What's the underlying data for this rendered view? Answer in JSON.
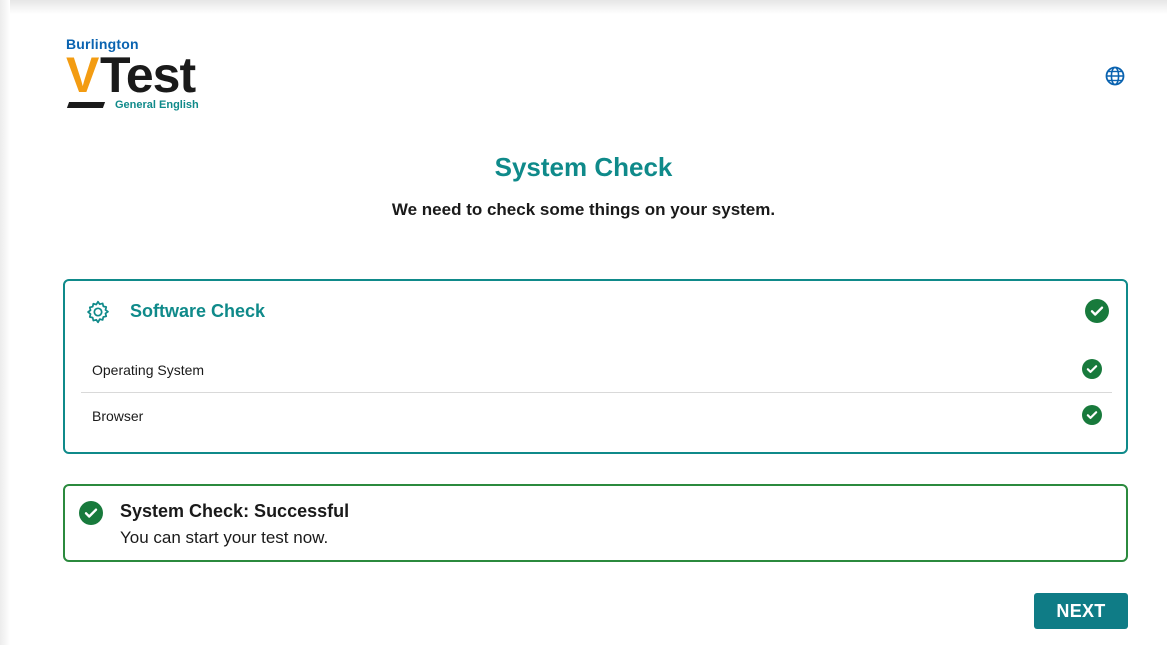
{
  "logo": {
    "brand": "Burlington",
    "v": "V",
    "test": "Test",
    "sub": "General English"
  },
  "header": {
    "language_icon": "globe-icon"
  },
  "page": {
    "title": "System Check",
    "subtitle": "We need to check some things on your system."
  },
  "software_check": {
    "icon": "gear-icon",
    "title": "Software Check",
    "status_icon": "check-circle-icon",
    "items": [
      {
        "label": "Operating System",
        "status_icon": "check-circle-icon"
      },
      {
        "label": "Browser",
        "status_icon": "check-circle-icon"
      }
    ]
  },
  "status": {
    "icon": "check-circle-icon",
    "title": "System Check: Successful",
    "message": "You can start your test now."
  },
  "actions": {
    "next_label": "NEXT"
  },
  "colors": {
    "teal": "#0f8a8a",
    "button": "#0f7c86",
    "success": "#187a3c",
    "logo_orange": "#f39c12",
    "logo_blue": "#0a63b0"
  }
}
